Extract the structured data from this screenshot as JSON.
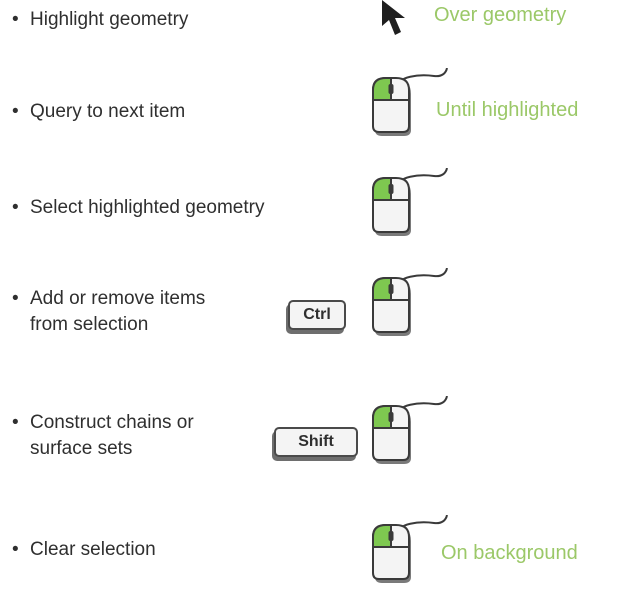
{
  "colors": {
    "text": "#2f2f2f",
    "note": "#9bc868",
    "button_highlight": "#7ec850"
  },
  "bullet": "•",
  "rows": [
    {
      "label_lines": [
        "Highlight geometry"
      ],
      "icon": "cursor-arrow-icon",
      "note": "Over geometry"
    },
    {
      "label_lines": [
        "Query to next item"
      ],
      "icon": "mouse-left-click-icon",
      "note": "Until highlighted"
    },
    {
      "label_lines": [
        "Select highlighted geometry"
      ],
      "icon": "mouse-left-click-icon"
    },
    {
      "label_lines": [
        "Add or remove items",
        "from selection"
      ],
      "key": "Ctrl",
      "icon": "mouse-left-click-icon"
    },
    {
      "label_lines": [
        "Construct chains or",
        "surface sets"
      ],
      "key": "Shift",
      "icon": "mouse-left-click-icon"
    },
    {
      "label_lines": [
        "Clear selection"
      ],
      "icon": "mouse-left-click-icon",
      "note": "On background"
    }
  ]
}
